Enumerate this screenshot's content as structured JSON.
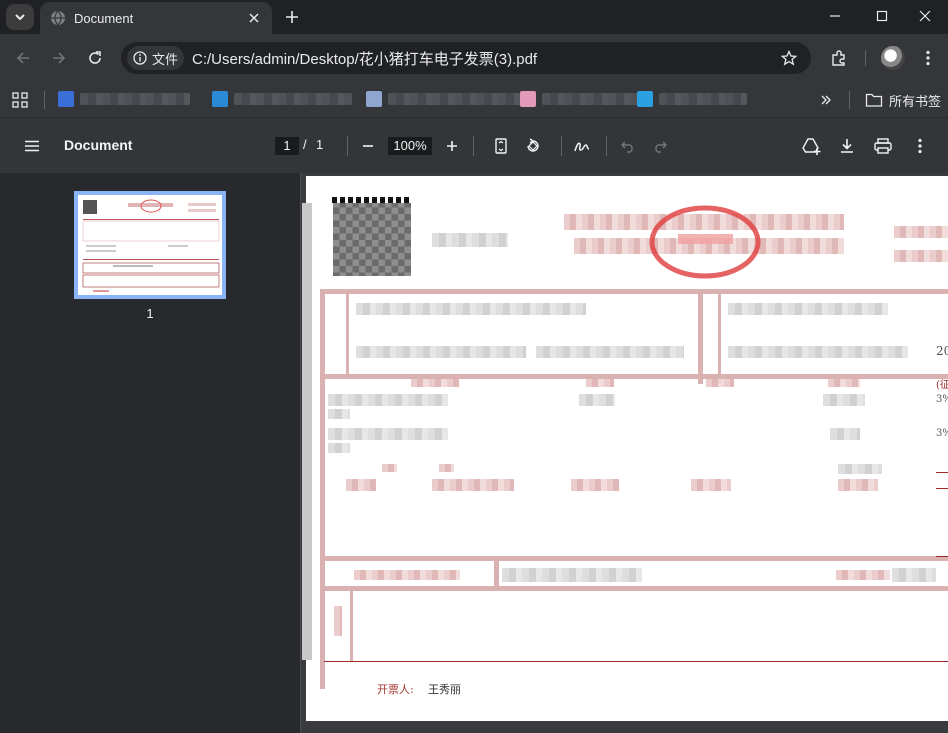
{
  "tab": {
    "title": "Document"
  },
  "omnibox": {
    "chip_label": "文件",
    "url": "C:/Users/admin/Desktop/花小猪打车电子发票(3).pdf"
  },
  "bookmarks": {
    "all_label": "所有书签"
  },
  "pdf": {
    "title": "Document",
    "page_current": "1",
    "page_slash": "/",
    "page_total": "1",
    "zoom": "100%",
    "thumbnail_number": "1"
  },
  "invoice": {
    "issuer_label": "开票人:",
    "issuer_name": "王秀丽",
    "rate_1": "3%",
    "rate_2": "3%",
    "right_text": "20",
    "right_col_label": "(征"
  },
  "colors": {
    "accent": "#8ab4f8",
    "stamp_red": "#e03c3c",
    "invoice_red": "#9b2a2a"
  },
  "icons": [
    "chevron-down-icon",
    "globe-icon",
    "close-icon",
    "plus-icon",
    "minimize-icon",
    "maximize-icon",
    "back-icon",
    "forward-icon",
    "reload-icon",
    "info-icon",
    "star-icon",
    "extensions-icon",
    "more-icon",
    "apps-icon",
    "chevrons-right-icon",
    "folder-icon",
    "menu-icon",
    "fit-page-icon",
    "rotate-icon",
    "annotate-icon",
    "undo-icon",
    "redo-icon",
    "drive-add-icon",
    "download-icon",
    "print-icon"
  ]
}
